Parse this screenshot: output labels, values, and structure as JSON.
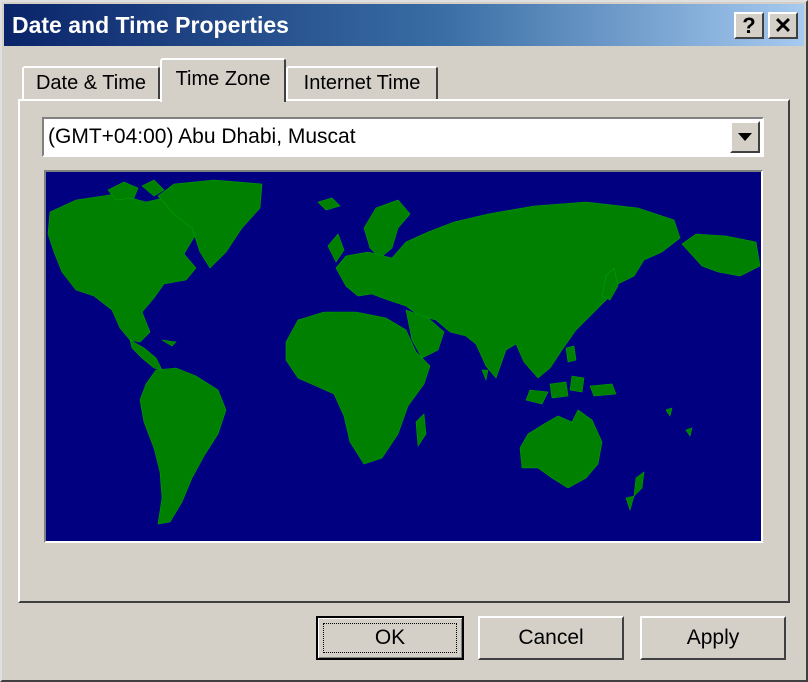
{
  "window": {
    "title": "Date and Time Properties",
    "help_label": "?",
    "close_label": "✕"
  },
  "tabs": [
    {
      "label": "Date & Time",
      "active": false
    },
    {
      "label": "Time Zone",
      "active": true
    },
    {
      "label": "Internet Time",
      "active": false
    }
  ],
  "timezone": {
    "selected": "(GMT+04:00) Abu Dhabi, Muscat"
  },
  "map": {
    "ocean_color": "#000080",
    "land_color": "#008000"
  },
  "buttons": {
    "ok": "OK",
    "cancel": "Cancel",
    "apply": "Apply"
  },
  "icons": {
    "dropdown": "chevron-down-icon",
    "help": "help-icon",
    "close": "close-icon"
  }
}
